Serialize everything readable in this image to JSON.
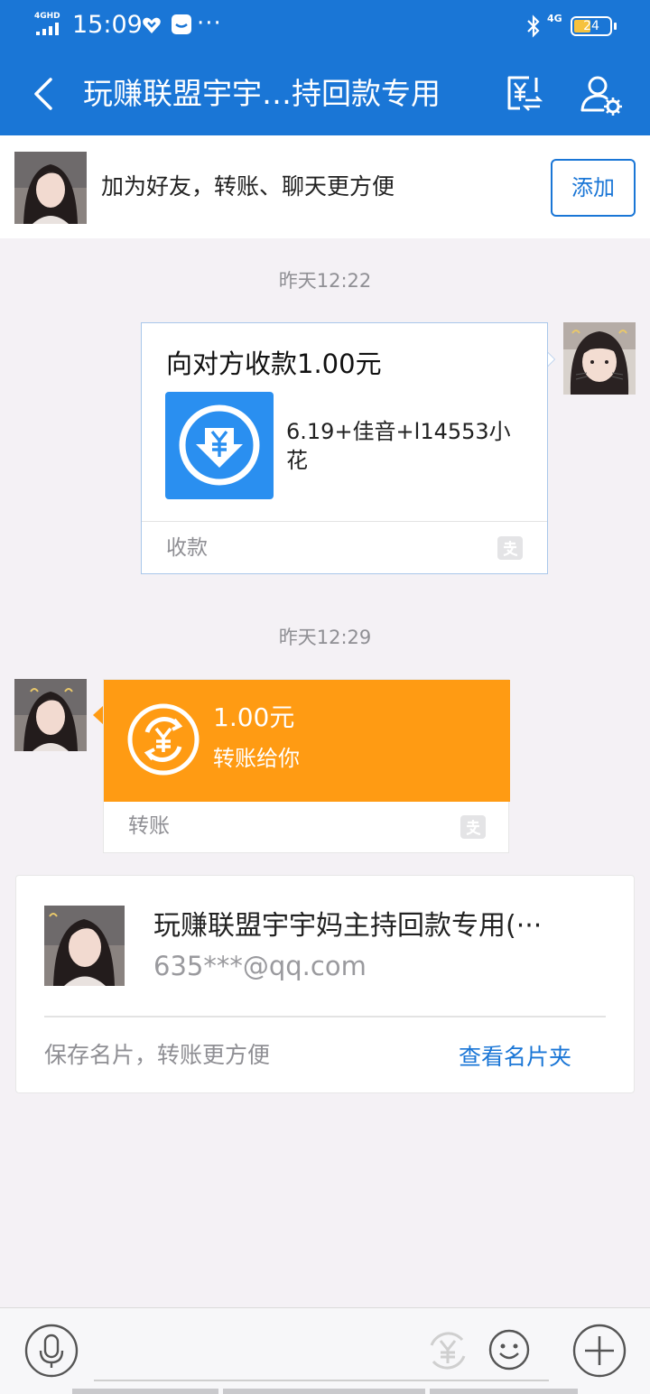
{
  "status_bar": {
    "network": "4GHD",
    "time": "15:09",
    "more": "···",
    "signal_4g": "4G",
    "battery": "24"
  },
  "header": {
    "title": "玩赚联盟宇宇…持回款专用"
  },
  "add_friend_banner": {
    "text": "加为好友，转账、聊天更方便",
    "button_label": "添加"
  },
  "messages": [
    {
      "timestamp": "昨天12:22",
      "type": "payment_request",
      "title": "向对方收款1.00元",
      "description": "6.19+佳音+l14553小花",
      "footer": "收款"
    },
    {
      "timestamp": "昨天12:29",
      "type": "transfer",
      "amount": "1.00元",
      "subtitle": "转账给你",
      "footer": "转账"
    }
  ],
  "contact_card": {
    "name": "玩赚联盟宇宇妈主持回款专用(···",
    "email": "635***@qq.com",
    "hint": "保存名片，转账更方便",
    "link": "查看名片夹"
  },
  "colors": {
    "brand_blue": "#1a76d6",
    "transfer_orange": "#ff9b13",
    "request_icon_blue": "#2a8ff0",
    "background": "#f4f1f5"
  },
  "icons": [
    "back-arrow-icon",
    "transfer-exchange-icon",
    "user-settings-icon",
    "yuan-receive-icon",
    "yuan-transfer-icon",
    "alipay-icon",
    "microphone-icon",
    "yuan-icon",
    "smiley-icon",
    "plus-icon"
  ]
}
